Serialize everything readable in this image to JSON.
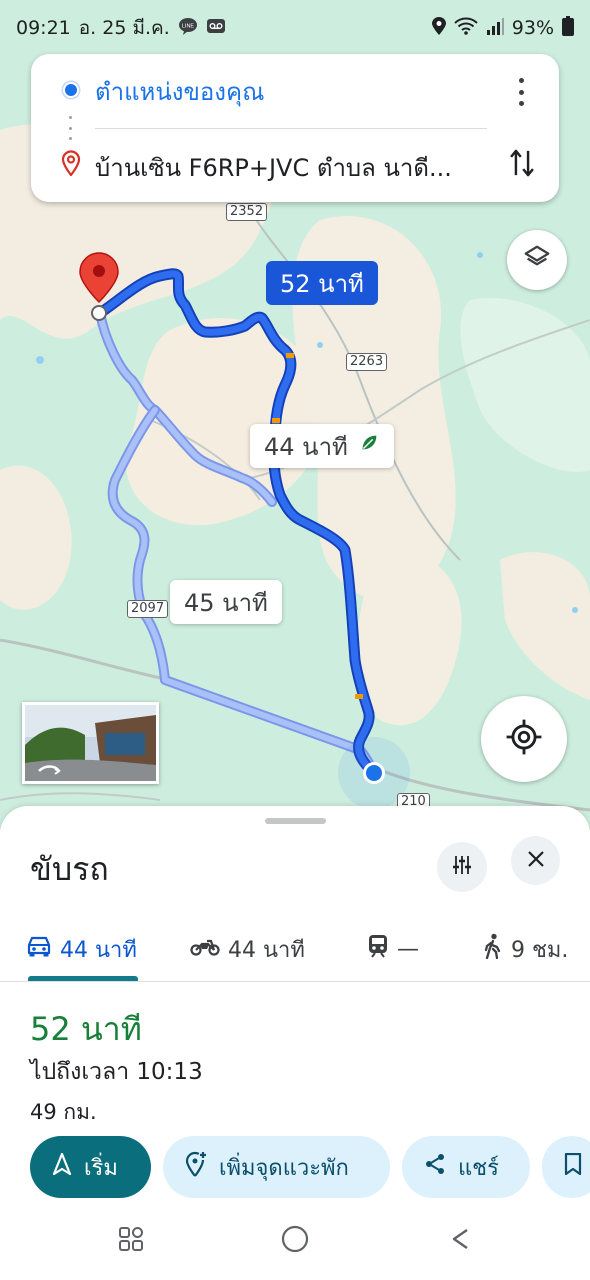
{
  "status_bar": {
    "time": "09:21",
    "date": "อ. 25 มี.ค.",
    "battery": "93%"
  },
  "search": {
    "origin": "ตำแหน่งของคุณ",
    "destination": "บ้านเซิน F6RP+JVC ตำบล นาดี..."
  },
  "map": {
    "route_labels": {
      "primary": "52 นาที",
      "alt1": "44 นาที",
      "alt2": "45 นาที"
    },
    "road_shields": [
      "2352",
      "2263",
      "2097",
      "210"
    ],
    "route_color": "#1a56d8",
    "alt_route_color": "#a7bdf7"
  },
  "sheet": {
    "title": "ขับรถ",
    "modes": [
      {
        "icon": "car-icon",
        "label": "44 นาที"
      },
      {
        "icon": "motorcycle-icon",
        "label": "44 นาที"
      },
      {
        "icon": "train-icon",
        "label": "—"
      },
      {
        "icon": "walk-icon",
        "label": "9 ชม."
      }
    ],
    "duration": "52 นาที",
    "arrival": "ไปถึงเวลา 10:13",
    "distance": "49 กม.",
    "actions": {
      "start": "เริ่ม",
      "add_stop": "เพิ่มจุดแวะพัก",
      "share": "แชร์"
    },
    "accent_color": "#0b6e7c",
    "duration_color": "#188038"
  }
}
